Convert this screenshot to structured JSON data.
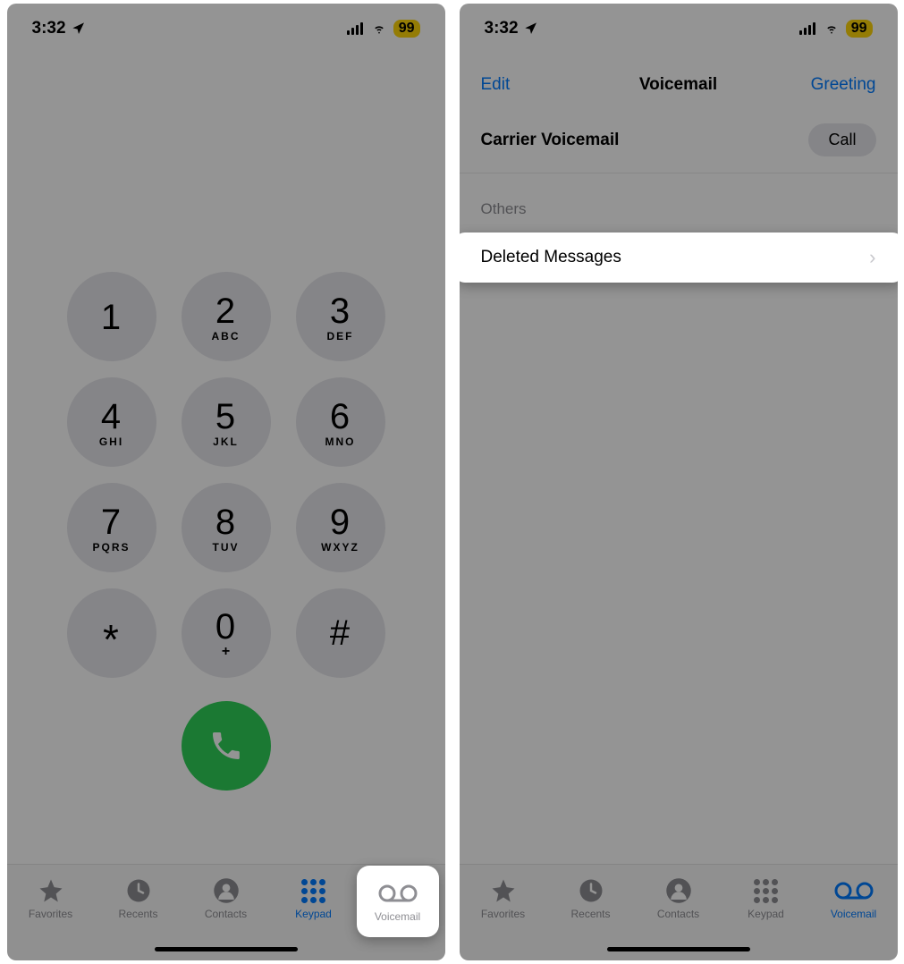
{
  "status": {
    "time": "3:32",
    "battery": "99"
  },
  "keypad": {
    "keys": [
      {
        "digit": "1",
        "letters": ""
      },
      {
        "digit": "2",
        "letters": "ABC"
      },
      {
        "digit": "3",
        "letters": "DEF"
      },
      {
        "digit": "4",
        "letters": "GHI"
      },
      {
        "digit": "5",
        "letters": "JKL"
      },
      {
        "digit": "6",
        "letters": "MNO"
      },
      {
        "digit": "7",
        "letters": "PQRS"
      },
      {
        "digit": "8",
        "letters": "TUV"
      },
      {
        "digit": "9",
        "letters": "WXYZ"
      },
      {
        "digit": "*",
        "letters": ""
      },
      {
        "digit": "0",
        "letters": "+"
      },
      {
        "digit": "#",
        "letters": ""
      }
    ]
  },
  "tabs": [
    {
      "label": "Favorites"
    },
    {
      "label": "Recents"
    },
    {
      "label": "Contacts"
    },
    {
      "label": "Keypad"
    },
    {
      "label": "Voicemail"
    }
  ],
  "voicemail": {
    "nav": {
      "left": "Edit",
      "title": "Voicemail",
      "right": "Greeting"
    },
    "carrier_label": "Carrier Voicemail",
    "call_label": "Call",
    "section_header": "Others",
    "deleted_label": "Deleted Messages"
  }
}
